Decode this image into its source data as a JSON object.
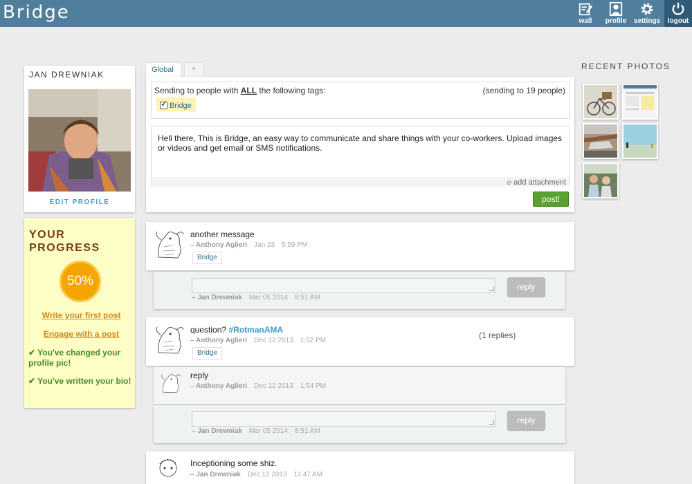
{
  "app": {
    "title": "Bridge"
  },
  "nav": {
    "wall": "wall",
    "profile": "profile",
    "settings": "settings",
    "logout": "logout"
  },
  "profile": {
    "name": "JAN DREWNIAK",
    "edit_label": "EDIT PROFILE"
  },
  "progress": {
    "title_line1": "YOUR",
    "title_line2": "PROGRESS",
    "percent": "50%",
    "todo": [
      "Write your first post",
      "Engage with a post"
    ],
    "done": [
      "✔ You've changed your profile pic!",
      "✔ You've written your bio!"
    ]
  },
  "tabs": {
    "global": "Global",
    "add": "+"
  },
  "composer": {
    "tag_label_pre": "Sending to people with ",
    "tag_label_all": "ALL",
    "tag_label_post": " the following tags:",
    "sending_count": "(sending to 19 people)",
    "selected_tag": "Bridge",
    "message": "Hell there, This is Bridge, an easy way to communicate and share things with your co-workers. Upload images or videos and get email or SMS notifications.",
    "attach_label": "add attachment",
    "post_label": "post!"
  },
  "posts": [
    {
      "title": "another message",
      "author": "– Anthony Aglieri",
      "date": "Jan 23",
      "time": "5:59 PM",
      "tag": "Bridge",
      "reply_author": "– Jan Drewniak",
      "reply_date": "Mar 05 2014",
      "reply_time": "8:51 AM",
      "reply_label": "reply"
    },
    {
      "title": "question? ",
      "hashtag": "#RotmanAMA",
      "author": "– Anthony Aglieri",
      "date": "Dec 12 2013",
      "time": "1:52 PM",
      "tag": "Bridge",
      "replies": "(1 replies)",
      "reply_text": "reply",
      "reply_text_author": "– Anthony Aglieri",
      "reply_text_date": "Dec 12 2013",
      "reply_text_time": "1:54 PM",
      "reply_author": "– Jan Drewniak",
      "reply_date": "Mar 05 2014",
      "reply_time": "8:51 AM",
      "reply_label": "reply"
    },
    {
      "title": "Inceptioning some shiz.",
      "author": "– Jan Drewniak",
      "date": "Dec 12 2013",
      "time": "11:47 AM"
    }
  ],
  "recent_photos": {
    "title": "RECENT PHOTOS"
  }
}
